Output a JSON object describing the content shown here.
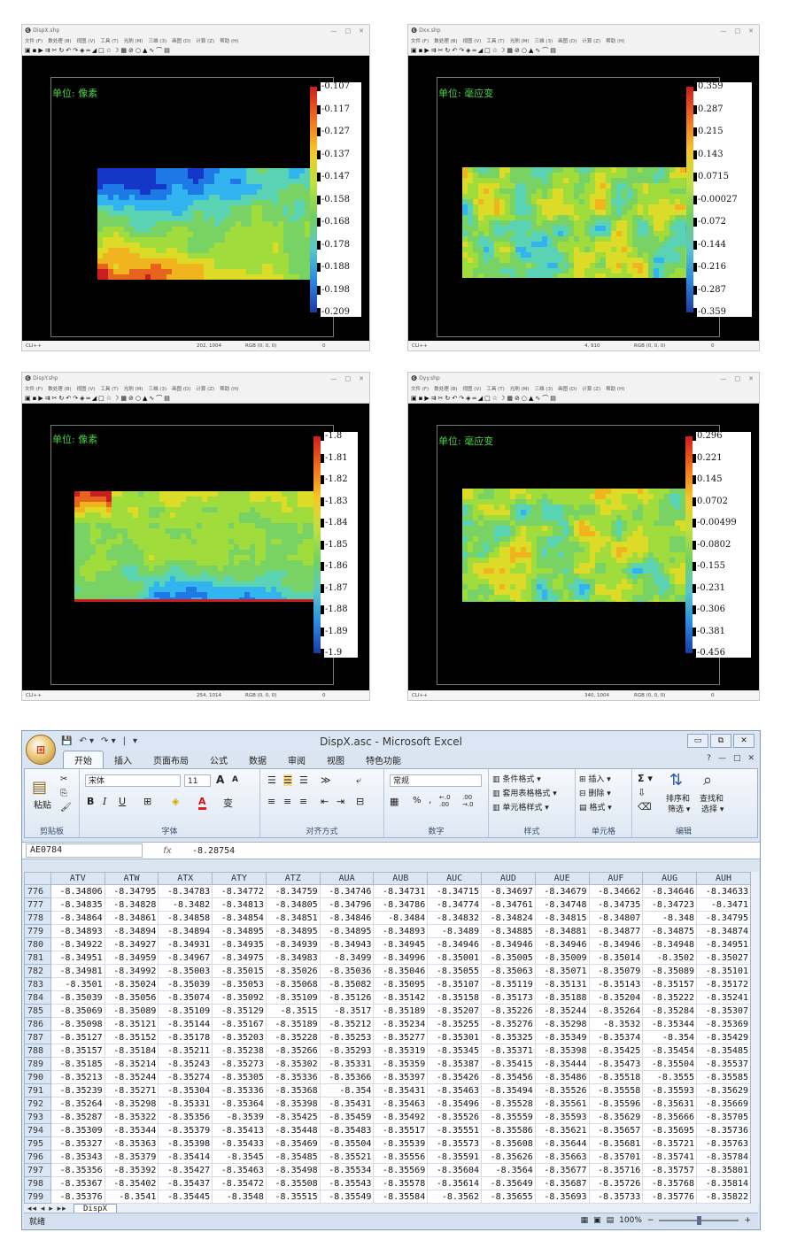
{
  "common": {
    "menu": [
      "文件 (F)",
      "数处理 (B)",
      "视图 (V)",
      "工具 (T)",
      "光刷 (M)",
      "三维 (3)",
      "画图 (D)",
      "计算 (Z)",
      "帮助 (H)"
    ],
    "toolbar_icons": [
      "open-icon",
      "save-icon",
      "play-icon",
      "next-icon",
      "cut-icon",
      "refresh-icon",
      "undo-icon",
      "redo-icon",
      "measure-icon",
      "line-icon",
      "area-icon",
      "rect-icon",
      "star-icon",
      "rotate-icon",
      "image-icon",
      "tag-icon",
      "circle-icon",
      "peak-icon",
      "wave-icon",
      "curve-icon",
      "grid-icon"
    ],
    "toolbar_glyphs": [
      "▣",
      "▪",
      "▶",
      "⇉",
      "✂",
      "↻",
      "↶",
      "↷",
      "◈",
      "═",
      "◢",
      "□",
      "☆",
      "☽",
      "▦",
      "⊘",
      "○",
      "▲",
      "∿",
      "⌒",
      "▤"
    ],
    "app_icon": "❻",
    "status_left": "CLI++",
    "min": "—",
    "max": "□",
    "close": "✕"
  },
  "panels": [
    {
      "title": "DispX.shp",
      "unit": "单位: 像素",
      "ticks": [
        "-0.107",
        "-0.117",
        "-0.127",
        "-0.137",
        "-0.147",
        "-0.158",
        "-0.168",
        "-0.178",
        "-0.188",
        "-0.198",
        "-0.209"
      ],
      "status_coord": "202, 1004",
      "status_rgb": "RGB (0, 0, 0)",
      "status_val": "0",
      "palette": "dispx"
    },
    {
      "title": "Dxx.shp",
      "unit": "单位: 毫应变",
      "ticks": [
        "0.359",
        "0.287",
        "0.215",
        "0.143",
        "0.0715",
        "-0.00027",
        "-0.072",
        "-0.144",
        "-0.216",
        "-0.287",
        "-0.359"
      ],
      "status_coord": "4, 910",
      "status_rgb": "RGB (0, 0, 0)",
      "status_val": "0",
      "palette": "dxx"
    },
    {
      "title": "DispY.shp",
      "unit": "单位: 像素",
      "ticks": [
        "-1.8",
        "-1.81",
        "-1.82",
        "-1.83",
        "-1.84",
        "-1.85",
        "-1.86",
        "-1.87",
        "-1.88",
        "-1.89",
        "-1.9"
      ],
      "status_coord": "254, 1014",
      "status_rgb": "RGB (0, 0, 0)",
      "status_val": "0",
      "palette": "dispy"
    },
    {
      "title": "Dyy.shp",
      "unit": "单位: 毫应变",
      "ticks": [
        "0.296",
        "0.221",
        "0.145",
        "0.0702",
        "-0.00499",
        "-0.0802",
        "-0.155",
        "-0.231",
        "-0.306",
        "-0.381",
        "-0.456"
      ],
      "status_coord": "340, 1004",
      "status_rgb": "RGB (0, 0, 0)",
      "status_val": "0",
      "palette": "dyy"
    }
  ],
  "excel": {
    "title": "DispX.asc - Microsoft Excel",
    "office_glyph": "⊞",
    "qat": [
      "💾",
      "↶ ▾",
      "↷ ▾",
      "|",
      "▾"
    ],
    "win_buttons": [
      "▭",
      "⧉",
      "✕"
    ],
    "tabs": [
      "开始",
      "插入",
      "页面布局",
      "公式",
      "数据",
      "审阅",
      "视图",
      "特色功能"
    ],
    "tab_right": [
      "?",
      "—",
      "□",
      "✕"
    ],
    "ribbon": {
      "clipboard": {
        "paste": "粘贴",
        "label": "剪贴板"
      },
      "font": {
        "name": "宋体",
        "size": "11",
        "grow": "A",
        "shrink": "A",
        "bold": "B",
        "italic": "I",
        "underline": "U",
        "label": "字体"
      },
      "align": {
        "label": "对齐方式"
      },
      "number": {
        "format": "常规",
        "percent": "%",
        "comma": ",",
        "inc": "←.0 .00",
        "dec": ".00 →.0",
        "label": "数字"
      },
      "styles": {
        "cond": "条件格式 ▾",
        "table": "套用表格格式 ▾",
        "cell": "单元格样式 ▾",
        "label": "样式"
      },
      "cells": {
        "insert": "插入 ▾",
        "delete": "删除 ▾",
        "format": "格式 ▾",
        "label": "单元格"
      },
      "edit": {
        "sum": "Σ ▾",
        "sort": "排序和",
        "sort2": "筛选 ▾",
        "find": "查找和",
        "find2": "选择 ▾",
        "label": "编辑"
      }
    },
    "name_box": "AE0784",
    "fx": "fx",
    "formula": "-8.28754",
    "columns": [
      "ATV",
      "ATW",
      "ATX",
      "ATY",
      "ATZ",
      "AUA",
      "AUB",
      "AUC",
      "AUD",
      "AUE",
      "AUF",
      "AUG",
      "AUH"
    ],
    "rows": [
      [
        "776",
        "-8.34806",
        "-8.34795",
        "-8.34783",
        "-8.34772",
        "-8.34759",
        "-8.34746",
        "-8.34731",
        "-8.34715",
        "-8.34697",
        "-8.34679",
        "-8.34662",
        "-8.34646",
        "-8.34633"
      ],
      [
        "777",
        "-8.34835",
        "-8.34828",
        "-8.3482",
        "-8.34813",
        "-8.34805",
        "-8.34796",
        "-8.34786",
        "-8.34774",
        "-8.34761",
        "-8.34748",
        "-8.34735",
        "-8.34723",
        "-8.3471"
      ],
      [
        "778",
        "-8.34864",
        "-8.34861",
        "-8.34858",
        "-8.34854",
        "-8.34851",
        "-8.34846",
        "-8.3484",
        "-8.34832",
        "-8.34824",
        "-8.34815",
        "-8.34807",
        "-8.348",
        "-8.34795"
      ],
      [
        "779",
        "-8.34893",
        "-8.34894",
        "-8.34894",
        "-8.34895",
        "-8.34895",
        "-8.34895",
        "-8.34893",
        "-8.3489",
        "-8.34885",
        "-8.34881",
        "-8.34877",
        "-8.34875",
        "-8.34874"
      ],
      [
        "780",
        "-8.34922",
        "-8.34927",
        "-8.34931",
        "-8.34935",
        "-8.34939",
        "-8.34943",
        "-8.34945",
        "-8.34946",
        "-8.34946",
        "-8.34946",
        "-8.34946",
        "-8.34948",
        "-8.34951"
      ],
      [
        "781",
        "-8.34951",
        "-8.34959",
        "-8.34967",
        "-8.34975",
        "-8.34983",
        "-8.3499",
        "-8.34996",
        "-8.35001",
        "-8.35005",
        "-8.35009",
        "-8.35014",
        "-8.3502",
        "-8.35027"
      ],
      [
        "782",
        "-8.34981",
        "-8.34992",
        "-8.35003",
        "-8.35015",
        "-8.35026",
        "-8.35036",
        "-8.35046",
        "-8.35055",
        "-8.35063",
        "-8.35071",
        "-8.35079",
        "-8.35089",
        "-8.35101"
      ],
      [
        "783",
        "-8.3501",
        "-8.35024",
        "-8.35039",
        "-8.35053",
        "-8.35068",
        "-8.35082",
        "-8.35095",
        "-8.35107",
        "-8.35119",
        "-8.35131",
        "-8.35143",
        "-8.35157",
        "-8.35172"
      ],
      [
        "784",
        "-8.35039",
        "-8.35056",
        "-8.35074",
        "-8.35092",
        "-8.35109",
        "-8.35126",
        "-8.35142",
        "-8.35158",
        "-8.35173",
        "-8.35188",
        "-8.35204",
        "-8.35222",
        "-8.35241"
      ],
      [
        "785",
        "-8.35069",
        "-8.35089",
        "-8.35109",
        "-8.35129",
        "-8.3515",
        "-8.3517",
        "-8.35189",
        "-8.35207",
        "-8.35226",
        "-8.35244",
        "-8.35264",
        "-8.35284",
        "-8.35307"
      ],
      [
        "786",
        "-8.35098",
        "-8.35121",
        "-8.35144",
        "-8.35167",
        "-8.35189",
        "-8.35212",
        "-8.35234",
        "-8.35255",
        "-8.35276",
        "-8.35298",
        "-8.3532",
        "-8.35344",
        "-8.35369"
      ],
      [
        "787",
        "-8.35127",
        "-8.35152",
        "-8.35178",
        "-8.35203",
        "-8.35228",
        "-8.35253",
        "-8.35277",
        "-8.35301",
        "-8.35325",
        "-8.35349",
        "-8.35374",
        "-8.354",
        "-8.35429"
      ],
      [
        "788",
        "-8.35157",
        "-8.35184",
        "-8.35211",
        "-8.35238",
        "-8.35266",
        "-8.35293",
        "-8.35319",
        "-8.35345",
        "-8.35371",
        "-8.35398",
        "-8.35425",
        "-8.35454",
        "-8.35485"
      ],
      [
        "789",
        "-8.35185",
        "-8.35214",
        "-8.35243",
        "-8.35273",
        "-8.35302",
        "-8.35331",
        "-8.35359",
        "-8.35387",
        "-8.35415",
        "-8.35444",
        "-8.35473",
        "-8.35504",
        "-8.35537"
      ],
      [
        "790",
        "-8.35213",
        "-8.35244",
        "-8.35274",
        "-8.35305",
        "-8.35336",
        "-8.35366",
        "-8.35397",
        "-8.35426",
        "-8.35456",
        "-8.35486",
        "-8.35518",
        "-8.3555",
        "-8.35585"
      ],
      [
        "791",
        "-8.35239",
        "-8.35271",
        "-8.35304",
        "-8.35336",
        "-8.35368",
        "-8.354",
        "-8.35431",
        "-8.35463",
        "-8.35494",
        "-8.35526",
        "-8.35558",
        "-8.35593",
        "-8.35629"
      ],
      [
        "792",
        "-8.35264",
        "-8.35298",
        "-8.35331",
        "-8.35364",
        "-8.35398",
        "-8.35431",
        "-8.35463",
        "-8.35496",
        "-8.35528",
        "-8.35561",
        "-8.35596",
        "-8.35631",
        "-8.35669"
      ],
      [
        "793",
        "-8.35287",
        "-8.35322",
        "-8.35356",
        "-8.3539",
        "-8.35425",
        "-8.35459",
        "-8.35492",
        "-8.35526",
        "-8.35559",
        "-8.35593",
        "-8.35629",
        "-8.35666",
        "-8.35705"
      ],
      [
        "794",
        "-8.35309",
        "-8.35344",
        "-8.35379",
        "-8.35413",
        "-8.35448",
        "-8.35483",
        "-8.35517",
        "-8.35551",
        "-8.35586",
        "-8.35621",
        "-8.35657",
        "-8.35695",
        "-8.35736"
      ],
      [
        "795",
        "-8.35327",
        "-8.35363",
        "-8.35398",
        "-8.35433",
        "-8.35469",
        "-8.35504",
        "-8.35539",
        "-8.35573",
        "-8.35608",
        "-8.35644",
        "-8.35681",
        "-8.35721",
        "-8.35763"
      ],
      [
        "796",
        "-8.35343",
        "-8.35379",
        "-8.35414",
        "-8.3545",
        "-8.35485",
        "-8.35521",
        "-8.35556",
        "-8.35591",
        "-8.35626",
        "-8.35663",
        "-8.35701",
        "-8.35741",
        "-8.35784"
      ],
      [
        "797",
        "-8.35356",
        "-8.35392",
        "-8.35427",
        "-8.35463",
        "-8.35498",
        "-8.35534",
        "-8.35569",
        "-8.35604",
        "-8.3564",
        "-8.35677",
        "-8.35716",
        "-8.35757",
        "-8.35801"
      ],
      [
        "798",
        "-8.35367",
        "-8.35402",
        "-8.35437",
        "-8.35472",
        "-8.35508",
        "-8.35543",
        "-8.35578",
        "-8.35614",
        "-8.35649",
        "-8.35687",
        "-8.35726",
        "-8.35768",
        "-8.35814"
      ],
      [
        "799",
        "-8.35376",
        "-8.3541",
        "-8.35445",
        "-8.3548",
        "-8.35515",
        "-8.35549",
        "-8.35584",
        "-8.3562",
        "-8.35655",
        "-8.35693",
        "-8.35733",
        "-8.35776",
        "-8.35822"
      ]
    ],
    "sheet_nav": "◂◂ ◂ ▸ ▸▸",
    "sheet_tab": "DispX",
    "status": "就绪",
    "zoom": "100%",
    "zoom_minus": "−",
    "zoom_plus": "+"
  }
}
